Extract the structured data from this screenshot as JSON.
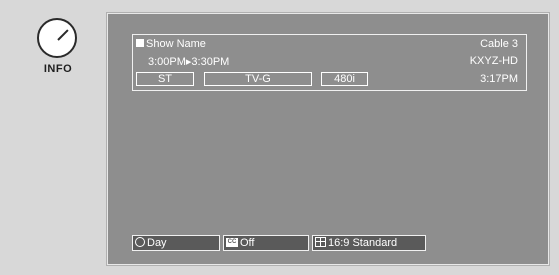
{
  "remote": {
    "button_label": "INFO"
  },
  "banner": {
    "show_name": "Show Name",
    "channel": "Cable 3",
    "time_range": "3:00PM▸3:30PM",
    "station": "KXYZ-HD",
    "audio": "ST",
    "rating": "TV-G",
    "resolution": "480i",
    "clock": "3:17PM"
  },
  "footer": {
    "day_label": "Day",
    "cc_icon_text": "CC",
    "cc_label": "Off",
    "aspect_label": "16:9 Standard"
  },
  "colors": {
    "screen_bg": "#8e8e8e",
    "footer_btn_bg": "#5a5a5a",
    "page_bg": "#d8d8d8"
  },
  "icons": [
    "info-knob-icon",
    "sun-icon",
    "closed-caption-icon",
    "aspect-ratio-icon"
  ]
}
